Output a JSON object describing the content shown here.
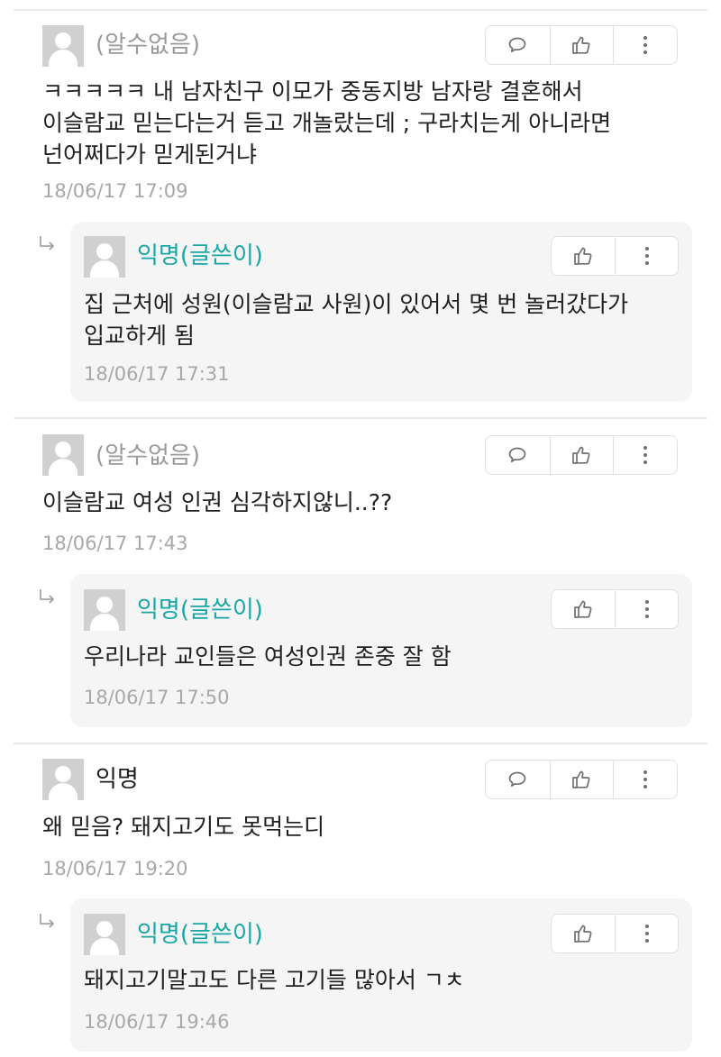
{
  "comments": [
    {
      "author": "(알수없음)",
      "text_lines": [
        "ㅋㅋㅋㅋㅋ 내 남자친구 이모가 중동지방 남자랑 결혼해서",
        "이슬람교 믿는다는거 듣고 개놀랐는데 ; 구라치는게 아니라면",
        "넌어쩌다가 믿게된거냐"
      ],
      "timestamp": "18/06/17 17:09",
      "reply": {
        "author": "익명(글쓴이)",
        "text_lines": [
          "집 근처에 성원(이슬람교 사원)이 있어서 몇 번 놀러갔다가",
          "입교하게 됨"
        ],
        "timestamp": "18/06/17 17:31"
      }
    },
    {
      "author": "(알수없음)",
      "text_lines": [
        "이슬람교 여성 인권 심각하지않니..??"
      ],
      "timestamp": "18/06/17 17:43",
      "reply": {
        "author": "익명(글쓴이)",
        "text_lines": [
          "우리나라 교인들은 여성인권 존중 잘 함"
        ],
        "timestamp": "18/06/17 17:50"
      }
    },
    {
      "author": "익명",
      "text_lines": [
        "왜 믿음? 돼지고기도 못먹는디"
      ],
      "timestamp": "18/06/17 19:20",
      "reply": {
        "author": "익명(글쓴이)",
        "text_lines": [
          "돼지고기말고도 다른 고기들 많아서 ㄱㅊ"
        ],
        "timestamp": "18/06/17 19:46"
      }
    }
  ],
  "icons": {
    "reply": "speech-bubble-icon",
    "like": "thumbs-up-icon",
    "more": "vertical-ellipsis-icon",
    "avatar": "default-profile-avatar",
    "reply_indicator": "reply-arrow-icon"
  },
  "colors": {
    "op_name": "#18a7a5",
    "anon_name": "#9a9a9a",
    "timestamp": "#a8a8a8",
    "reply_bg": "#f5f5f5",
    "separator": "#e9e9e9"
  }
}
